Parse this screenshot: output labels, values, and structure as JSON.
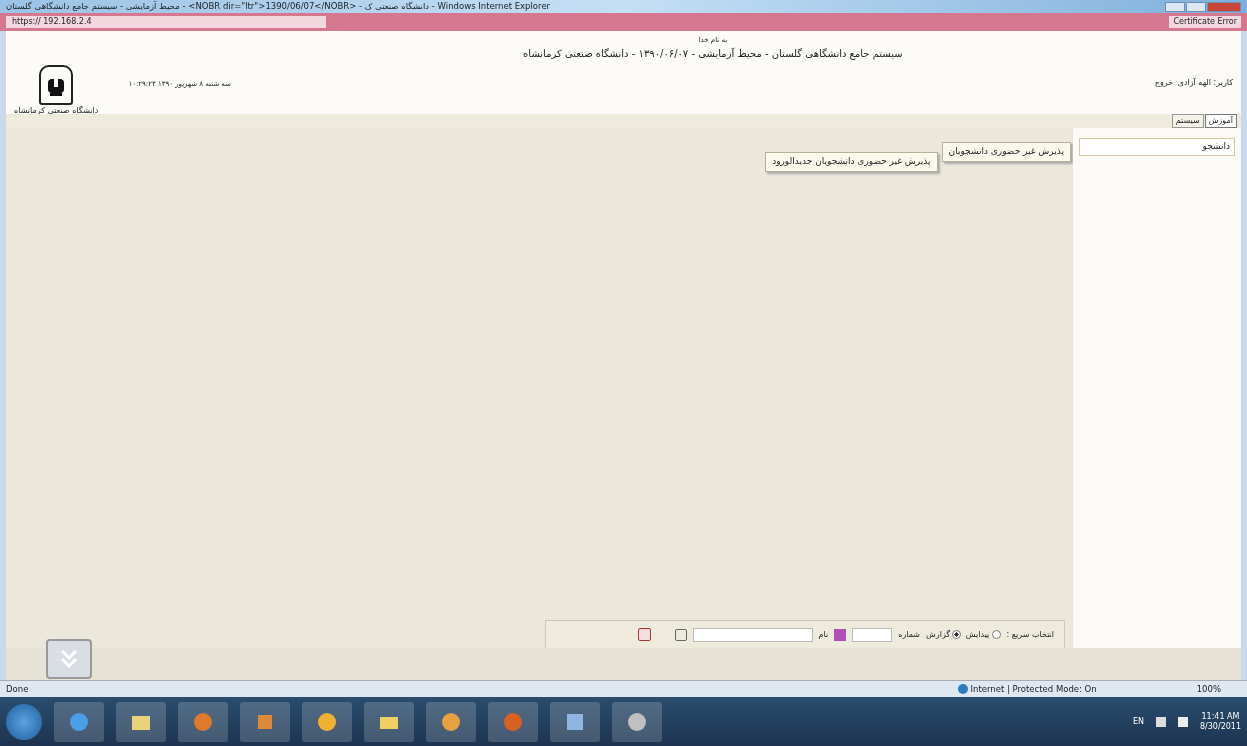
{
  "window": {
    "title": "محیط آزمایشی - سیستم جامع دانشگاهی گلستان - <NOBR dir=\"ltr\">1390/06/07</NOBR> - دانشگاه صنعتی ک - Windows Internet Explorer"
  },
  "address_bar": {
    "url": "https:// 192.168.2.4",
    "certificate": "Certificate Error"
  },
  "header": {
    "greeting": "به نام خدا",
    "title": "سیستم جامع دانشگاهی گلستان - محیط آزمایشی - ۱۳۹۰/۰۶/۰۷ - دانشگاه صنعتی کرمانشاه",
    "datetime": "۱۰:۲۹:۲۳ سه شنبه ۸ شهریور ۱۳۹۰",
    "logo_caption": "دانشگاه صنعتی کرمانشاه",
    "user": "کاربر: الهه آزادی",
    "logout": "خروج"
  },
  "tabs": [
    {
      "label": "آموزش",
      "selected": true
    },
    {
      "label": "سیستم",
      "selected": false
    }
  ],
  "sidebar": {
    "value": "دانشجو"
  },
  "menu": {
    "item": "پذیرش غیر حضوری دانشجویان",
    "submenu": "پذیرش غیر حضوری دانشجویان جدیدالورود"
  },
  "quick_select": {
    "label": "انتخاب سریع :",
    "options": [
      {
        "label": "پیدایش",
        "selected": false
      },
      {
        "label": "گزارش",
        "selected": true
      }
    ],
    "number_label": "شماره",
    "name_label": "نام"
  },
  "status_bar": {
    "left": "Done",
    "zone": "Internet | Protected Mode: On",
    "zoom": "100%"
  },
  "taskbar": {
    "language": "EN",
    "time": "11:41 AM",
    "date": "8/30/2011"
  }
}
